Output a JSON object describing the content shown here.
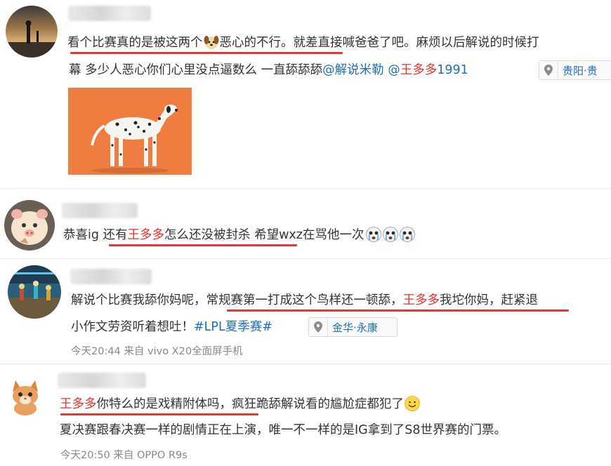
{
  "comments": [
    {
      "avatar_icon": "sunset-silhouette-avatar-icon",
      "text_line1": {
        "part1": "看个比赛真的是被这两个",
        "emoji": "dog-face-emoji-icon",
        "part2": "恶心的不行。就差直接喊爸爸了吧。麻烦以后解说的时候",
        "tail": "打"
      },
      "text_line2": {
        "part1": "幕 多少人恶心你们心里没点逼数么 一直舔舔舔",
        "mention1": "@解说米勒",
        "space": " ",
        "mention2_at": "@",
        "mention2_red": "王多多",
        "mention2_tail": "1991"
      },
      "location": "贵阳·贵",
      "location_icon": "location-pin-icon",
      "image_icon": "dalmatian-dog-photo"
    },
    {
      "avatar_icon": "cartoon-pig-avatar-icon",
      "text": {
        "part1": "恭喜ig ",
        "part2": "还有",
        "red": "王多多",
        "part3": "怎么还没被封杀 希望wxz在骂他一次"
      },
      "emojis": [
        "crying-face-emoji-icon",
        "crying-face-emoji-icon",
        "crying-face-emoji-icon"
      ]
    },
    {
      "avatar_icon": "stage-crowd-avatar-icon",
      "text_line1": {
        "part1": "解说个比赛我舔你妈呢，常规赛第一打成这个鸟样还一顿舔，",
        "red": "王多多",
        "part2": "我坨你妈，赶紧退"
      },
      "text_line2": {
        "part1": "小作文劳资听着想吐！",
        "topic": "#LPL夏季赛#"
      },
      "location": "金华·永康",
      "location_icon": "location-pin-icon",
      "meta": {
        "time": "今天20:44",
        "from": "来自",
        "device": "vivo X20全面屏手机"
      }
    },
    {
      "avatar_icon": "kitten-avatar-icon",
      "text_line1": {
        "red": "王多多",
        "part1": "你特么的是戏精附体吗，疯狂跪舔解说看的尴尬症都犯了",
        "emoji": "smiley-face-emoji-icon"
      },
      "text_line2": "夏决赛跟春决赛一样的剧情正在上演，唯一不一样的是IG拿到了S8世界赛的门票。",
      "meta": {
        "time": "今天20:50",
        "from": "来自",
        "device": "OPPO R9s"
      }
    }
  ],
  "colors": {
    "link": "#1e6fb5",
    "highlight_red": "#e0332e",
    "underline": "#e53935",
    "meta": "#888888"
  }
}
